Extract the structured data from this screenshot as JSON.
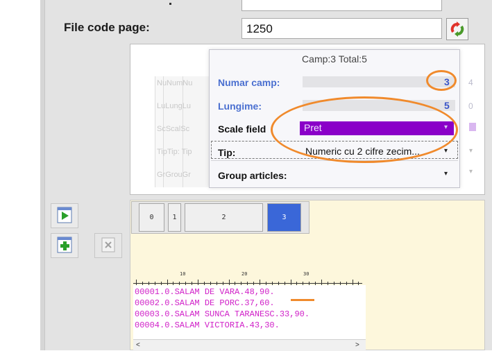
{
  "colors": {
    "accent_blue": "#4a6fd0",
    "scale_field_bg": "#8a00c8",
    "annotation_orange": "#f08a2c",
    "text_lines": "#d020c8",
    "selected_cell": "#3a67d8",
    "editor_bg": "#fdf7dc"
  },
  "header": {
    "file_code_page_label": "File code page:",
    "file_code_page_value": "1250",
    "refresh_icon": "refresh-icon"
  },
  "panel": {
    "ghost_labels": [
      "NuNumNu",
      "LuLungLu",
      "ScScalSc",
      "TipTip: Tip",
      "GrGrouGr"
    ],
    "ghost_right_values": [
      "4",
      "0"
    ],
    "card": {
      "title": "Camp:3 Total:5",
      "numar_label": "Numar camp:",
      "numar_value": "3",
      "lungime_label": "Lungime:",
      "lungime_value": "5",
      "scale_label": "Scale field",
      "scale_value": "Pret",
      "tip_label": "Tip:",
      "tip_value": "Numeric cu 2 cifre zecim...",
      "group_label": "Group articles:"
    }
  },
  "toolbar": {
    "play_icon": "play-icon",
    "add_icon": "add-field-icon",
    "delete_icon": "delete-field-icon"
  },
  "editor": {
    "cells": [
      "0",
      "1",
      "2",
      "3"
    ],
    "ruler_numbers": [
      "10",
      "20",
      "30"
    ],
    "lines": [
      "00001.0.SALAM DE VARA.48,90.",
      "00002.0.SALAM DE PORC.37,60.",
      "00003.0.SALAM SUNCA TARANESC.33,90.",
      "00004.0.SALAM VICTORIA.43,30."
    ],
    "scroll_left": "<",
    "scroll_right": ">"
  }
}
